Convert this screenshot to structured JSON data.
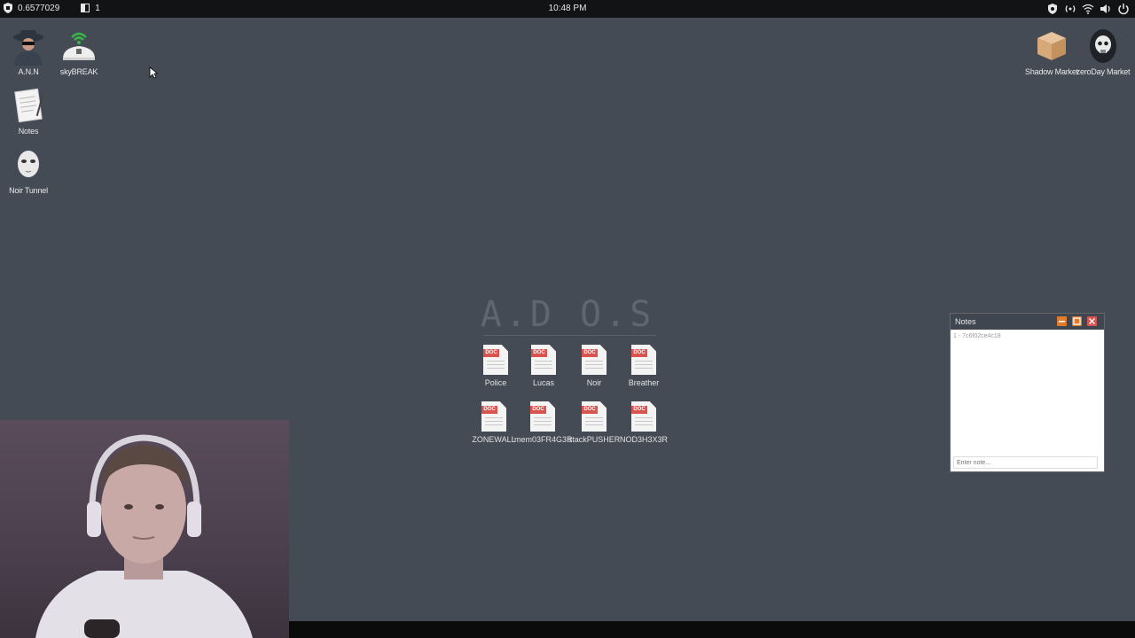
{
  "topbar": {
    "left_value": "0.6577029",
    "left_count": "1",
    "clock": "10:48 PM"
  },
  "desktop_icons_left": [
    {
      "label": "A.N.N",
      "icon": "hacker-avatar-icon"
    },
    {
      "label": "skyBREAK",
      "icon": "wifi-router-icon"
    },
    {
      "label": "Notes",
      "icon": "notepad-icon"
    },
    {
      "label": "Noir Tunnel",
      "icon": "mask-icon"
    }
  ],
  "desktop_icons_right": [
    {
      "label": "Shadow Market",
      "icon": "package-box-icon"
    },
    {
      "label": "zeroDay Market",
      "icon": "skull-icon"
    }
  ],
  "ados": {
    "title": "A.D O.S",
    "documents": [
      {
        "label": "Police",
        "tag": "DOC"
      },
      {
        "label": "Lucas",
        "tag": "DOC"
      },
      {
        "label": "Noir",
        "tag": "DOC"
      },
      {
        "label": "Breather",
        "tag": "DOC"
      },
      {
        "label": "ZONEWALL",
        "tag": "DOC"
      },
      {
        "label": "mem03FR4G3R",
        "tag": "DOC"
      },
      {
        "label": "stackPUSHER",
        "tag": "DOC"
      },
      {
        "label": "NOD3H3X3R",
        "tag": "DOC"
      }
    ]
  },
  "notes_window": {
    "title": "Notes",
    "entry": "1 - 7c6f02ce4c18",
    "placeholder": "Enter note..."
  },
  "colors": {
    "desktop": "#444b55",
    "topbar": "#111315",
    "doc_tag": "#d9534f",
    "win_min": "#e07b2c",
    "win_close": "#d9534f"
  }
}
